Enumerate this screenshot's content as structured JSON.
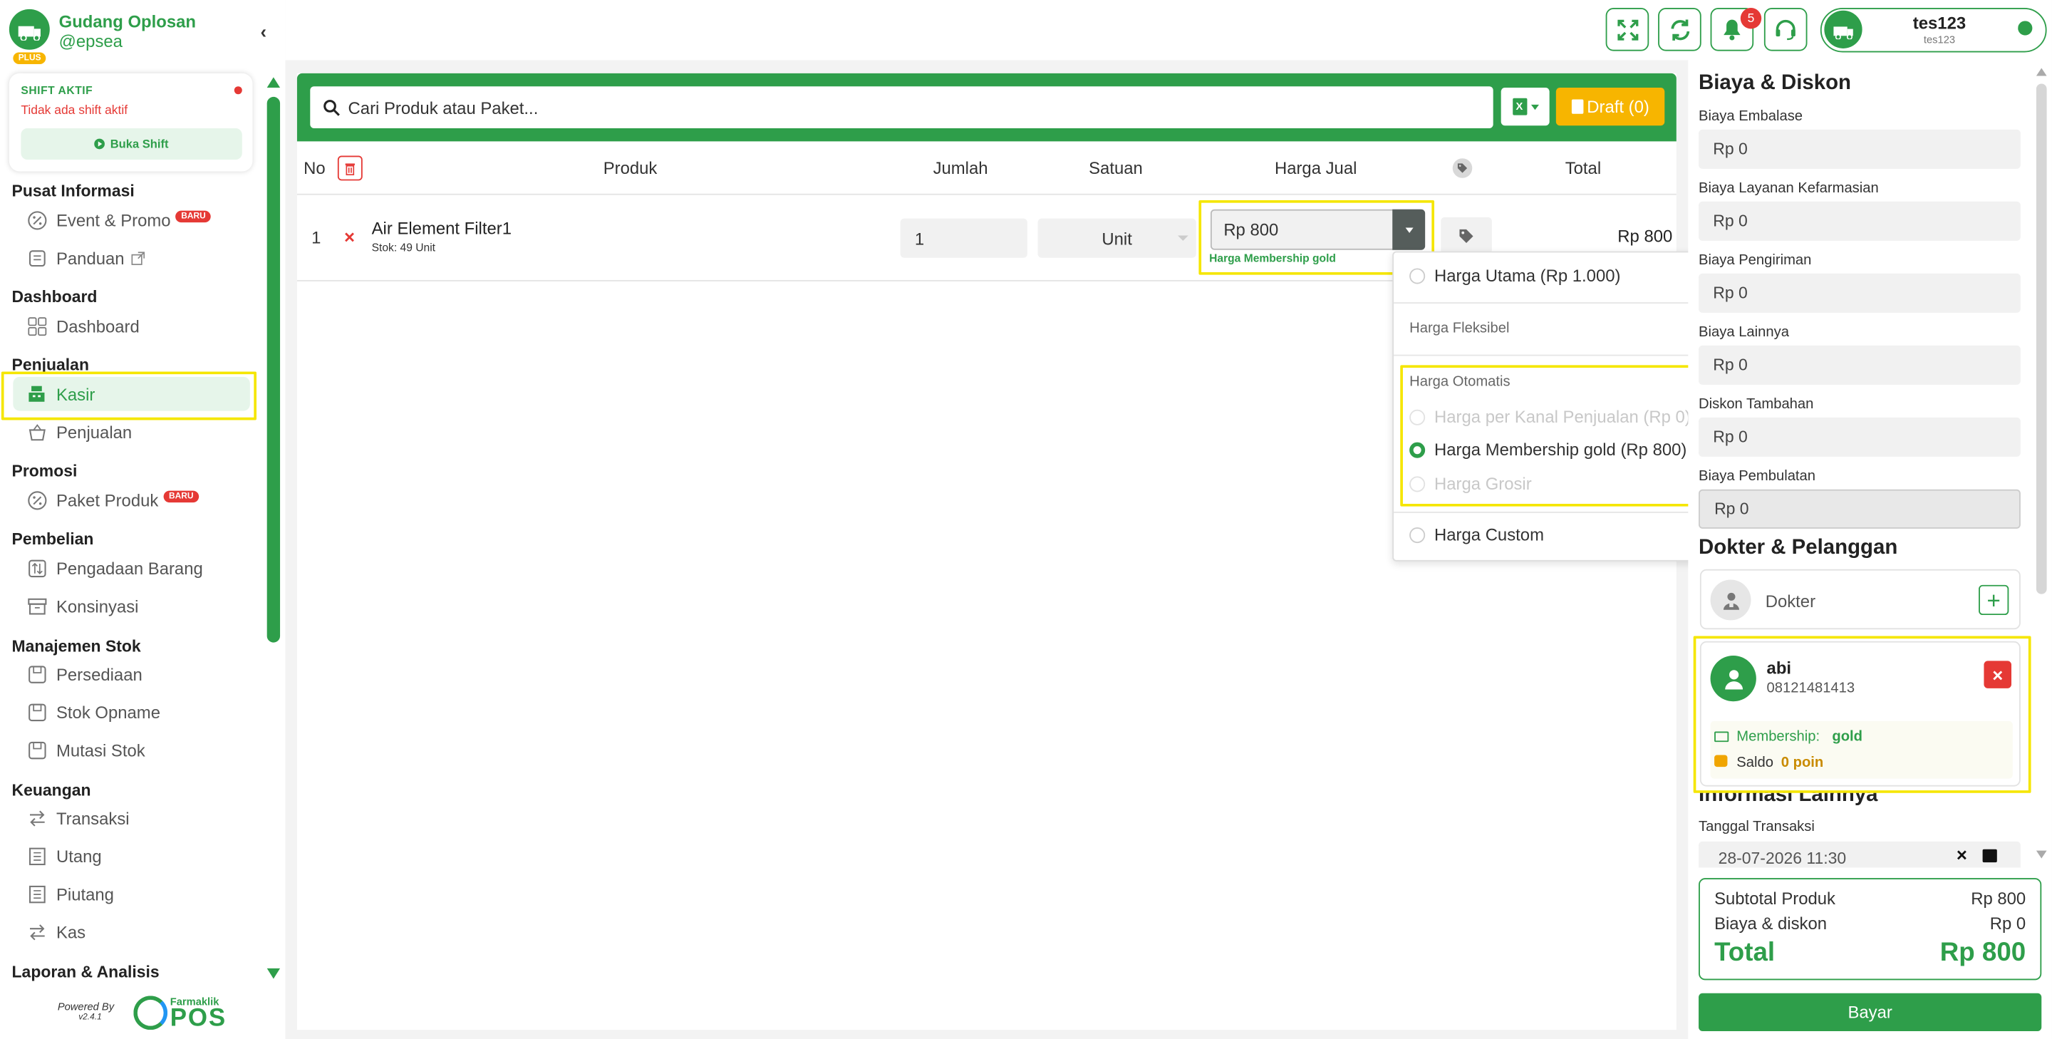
{
  "store": {
    "name": "Gudang Oplosan",
    "handle": "@epsea",
    "plan": "PLUS"
  },
  "shift": {
    "title": "SHIFT AKTIF",
    "status": "Tidak ada shift aktif",
    "button": "Buka Shift"
  },
  "nav": {
    "pusat_informasi": {
      "heading": "Pusat Informasi",
      "event": "Event & Promo",
      "event_badge": "BARU",
      "panduan": "Panduan"
    },
    "dashboard": {
      "heading": "Dashboard",
      "dashboard": "Dashboard"
    },
    "penjualan": {
      "heading": "Penjualan",
      "kasir": "Kasir",
      "penjualan": "Penjualan"
    },
    "promosi": {
      "heading": "Promosi",
      "paket": "Paket Produk",
      "paket_badge": "BARU"
    },
    "pembelian": {
      "heading": "Pembelian",
      "pengadaan": "Pengadaan Barang",
      "konsinyasi": "Konsinyasi"
    },
    "stok": {
      "heading": "Manajemen Stok",
      "persediaan": "Persediaan",
      "opname": "Stok Opname",
      "mutasi": "Mutasi Stok"
    },
    "keuangan": {
      "heading": "Keuangan",
      "transaksi": "Transaksi",
      "utang": "Utang",
      "piutang": "Piutang",
      "kas": "Kas"
    },
    "laporan": {
      "heading": "Laporan & Analisis"
    }
  },
  "footer": {
    "powered": "Powered By",
    "version": "v2.4.1",
    "brand_small": "Farmaklik",
    "brand": "POS"
  },
  "header": {
    "notif_count": "5",
    "user_name": "tes123",
    "user_sub": "tes123"
  },
  "search": {
    "placeholder": "Cari Produk atau Paket...",
    "draft_label": "Draft (0)"
  },
  "table": {
    "headers": {
      "no": "No",
      "produk": "Produk",
      "jumlah": "Jumlah",
      "satuan": "Satuan",
      "harga": "Harga Jual",
      "total": "Total"
    },
    "rows": [
      {
        "no": "1",
        "name": "Air Element Filter1",
        "stock": "Stok: 49 Unit",
        "qty": "1",
        "unit": "Unit",
        "price": "Rp 800",
        "price_note": "Harga Membership gold",
        "total": "Rp 800"
      }
    ]
  },
  "price_dropdown": {
    "utama": "Harga Utama (Rp 1.000)",
    "fleksibel_label": "Harga Fleksibel",
    "otomatis_label": "Harga Otomatis",
    "kanal": "Harga per Kanal Penjualan (Rp 0)",
    "membership": "Harga Membership gold (Rp 800)",
    "grosir": "Harga Grosir",
    "custom": "Harga Custom"
  },
  "costs": {
    "heading": "Biaya & Diskon",
    "embalase_label": "Biaya Embalase",
    "embalase": "Rp 0",
    "layanan_label": "Biaya Layanan Kefarmasian",
    "layanan": "Rp 0",
    "pengiriman_label": "Biaya Pengiriman",
    "pengiriman": "Rp 0",
    "lainnya_label": "Biaya Lainnya",
    "lainnya": "Rp 0",
    "diskon_label": "Diskon Tambahan",
    "diskon": "Rp 0",
    "pembulatan_label": "Biaya Pembulatan",
    "pembulatan": "Rp 0"
  },
  "people": {
    "heading": "Dokter & Pelanggan",
    "dokter_placeholder": "Dokter",
    "customer_name": "abi",
    "customer_phone": "08121481413",
    "membership_label": "Membership:",
    "membership_value": "gold",
    "saldo_label": "Saldo",
    "saldo_value": "0 poin"
  },
  "info": {
    "heading": "Informasi Lainnya",
    "tanggal_label": "Tanggal Transaksi",
    "tanggal": "28-07-2026 11:30"
  },
  "summary": {
    "subtotal_label": "Subtotal Produk",
    "subtotal": "Rp 800",
    "biaya_label": "Biaya & diskon",
    "biaya": "Rp 0",
    "total_label": "Total",
    "total": "Rp 800"
  },
  "pay_button": "Bayar",
  "colors": {
    "primary": "#2e9e4a",
    "highlight": "#f5e600",
    "draft": "#f7b500",
    "danger": "#e53935"
  }
}
